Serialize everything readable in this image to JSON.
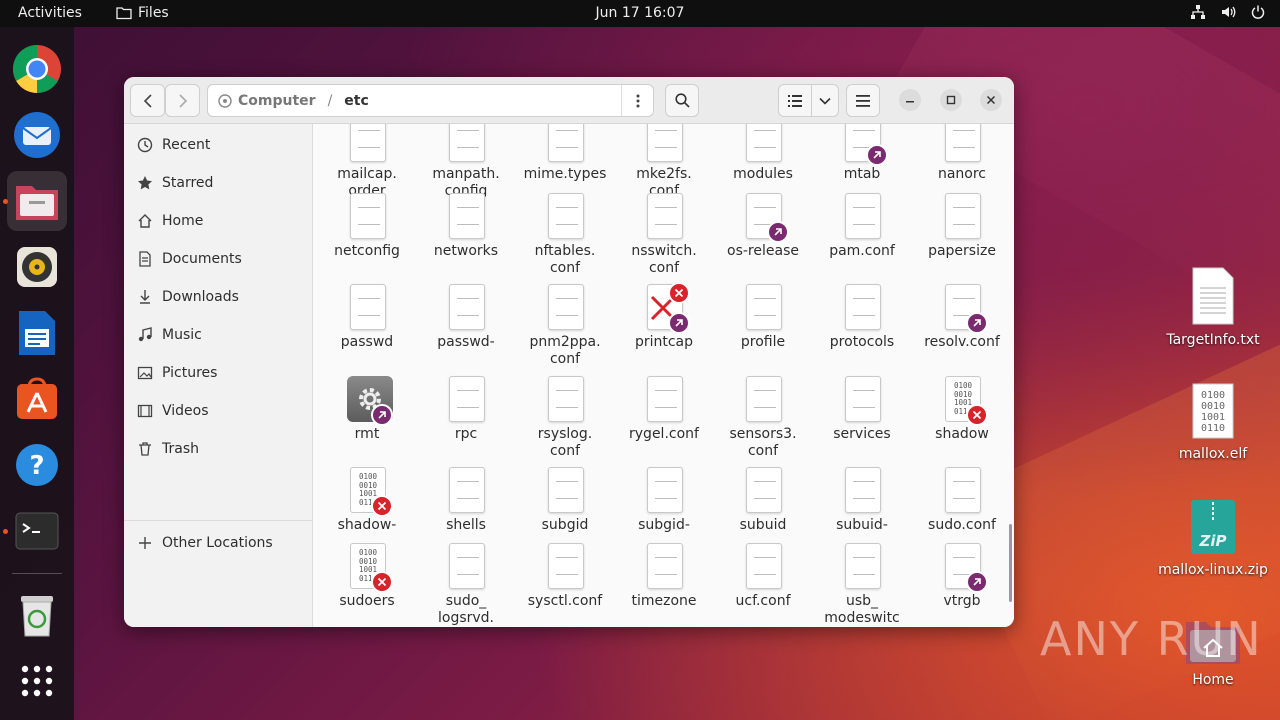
{
  "topbar": {
    "activities": "Activities",
    "app_name": "Files",
    "clock": "Jun 17  16:07"
  },
  "dock": {
    "apps": [
      "chrome-icon",
      "thunderbird-icon",
      "files-icon",
      "rhythmbox-icon",
      "writer-icon",
      "app-center-icon",
      "help-icon",
      "terminal-icon",
      "trash-icon",
      "app-grid-icon"
    ]
  },
  "window": {
    "path": {
      "root": "Computer",
      "current": "etc"
    },
    "sidebar": {
      "items": [
        {
          "label": "Recent",
          "icon": "clock-icon"
        },
        {
          "label": "Starred",
          "icon": "star-icon"
        },
        {
          "label": "Home",
          "icon": "home-icon"
        },
        {
          "label": "Documents",
          "icon": "document-icon"
        },
        {
          "label": "Downloads",
          "icon": "download-icon"
        },
        {
          "label": "Music",
          "icon": "music-icon"
        },
        {
          "label": "Pictures",
          "icon": "picture-icon"
        },
        {
          "label": "Videos",
          "icon": "video-icon"
        },
        {
          "label": "Trash",
          "icon": "trash-icon"
        }
      ],
      "other_locations": "Other Locations"
    },
    "files": [
      {
        "name": "mailcap.\norder",
        "icon": "text-file"
      },
      {
        "name": "manpath.\nconfig",
        "icon": "text-file"
      },
      {
        "name": "mime.types",
        "icon": "text-file"
      },
      {
        "name": "mke2fs.\nconf",
        "icon": "text-file"
      },
      {
        "name": "modules",
        "icon": "text-file"
      },
      {
        "name": "mtab",
        "icon": "text-file-link"
      },
      {
        "name": "nanorc",
        "icon": "text-file"
      },
      {
        "name": "netconfig",
        "icon": "text-file"
      },
      {
        "name": "networks",
        "icon": "text-file"
      },
      {
        "name": "nftables.\nconf",
        "icon": "text-file"
      },
      {
        "name": "nsswitch.\nconf",
        "icon": "text-file"
      },
      {
        "name": "os-release",
        "icon": "text-file-link"
      },
      {
        "name": "pam.conf",
        "icon": "text-file"
      },
      {
        "name": "papersize",
        "icon": "text-file"
      },
      {
        "name": "passwd",
        "icon": "text-file"
      },
      {
        "name": "passwd-",
        "icon": "text-file"
      },
      {
        "name": "pnm2ppa.\nconf",
        "icon": "text-file"
      },
      {
        "name": "printcap",
        "icon": "broken-link"
      },
      {
        "name": "profile",
        "icon": "text-file"
      },
      {
        "name": "protocols",
        "icon": "text-file"
      },
      {
        "name": "resolv.conf",
        "icon": "text-file-link"
      },
      {
        "name": "rmt",
        "icon": "exec-link"
      },
      {
        "name": "rpc",
        "icon": "text-file"
      },
      {
        "name": "rsyslog.\nconf",
        "icon": "text-file"
      },
      {
        "name": "rygel.conf",
        "icon": "text-file"
      },
      {
        "name": "sensors3.\nconf",
        "icon": "text-file"
      },
      {
        "name": "services",
        "icon": "text-file"
      },
      {
        "name": "shadow",
        "icon": "binary-noaccess"
      },
      {
        "name": "shadow-",
        "icon": "binary-noaccess"
      },
      {
        "name": "shells",
        "icon": "text-file"
      },
      {
        "name": "subgid",
        "icon": "text-file"
      },
      {
        "name": "subgid-",
        "icon": "text-file"
      },
      {
        "name": "subuid",
        "icon": "text-file"
      },
      {
        "name": "subuid-",
        "icon": "text-file"
      },
      {
        "name": "sudo.conf",
        "icon": "text-file"
      },
      {
        "name": "sudoers",
        "icon": "binary-noaccess"
      },
      {
        "name": "sudo_\nlogsrvd.",
        "icon": "text-file"
      },
      {
        "name": "sysctl.conf",
        "icon": "text-file"
      },
      {
        "name": "timezone",
        "icon": "text-file"
      },
      {
        "name": "ucf.conf",
        "icon": "text-file"
      },
      {
        "name": "usb_\nmodeswitc",
        "icon": "text-file"
      },
      {
        "name": "vtrgb",
        "icon": "text-file-link"
      }
    ],
    "binary_glyph": "0100\n0010\n1001\n0110"
  },
  "desktop": [
    {
      "name": "TargetInfo.txt",
      "icon": "text-file-icon"
    },
    {
      "name": "mallox.elf",
      "icon": "binary-file-icon"
    },
    {
      "name": "mallox-linux.zip",
      "icon": "zip-file-icon"
    },
    {
      "name": "Home",
      "icon": "home-folder-icon"
    }
  ],
  "zip_label": "ZiP",
  "watermark": "ANY RUN",
  "colors": {
    "accent": "#e95420",
    "link_badge": "#7a2a6e",
    "noaccess_badge": "#d8232a"
  }
}
